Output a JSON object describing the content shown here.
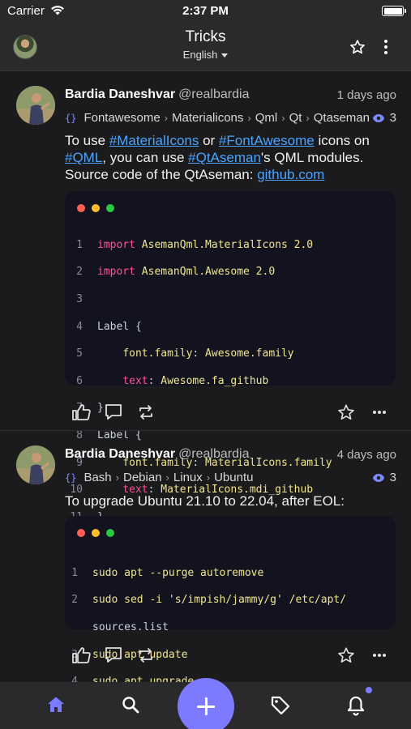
{
  "status": {
    "carrier": "Carrier",
    "time": "2:37 PM"
  },
  "header": {
    "title": "Tricks",
    "language": "English"
  },
  "posts": [
    {
      "author": "Bardia Daneshvar",
      "handle": "@realbardia",
      "time": "1 days ago",
      "tags": [
        "Fontawesome",
        "Materialicons",
        "Qml",
        "Qt",
        "Qtaseman"
      ],
      "views": "3",
      "text": {
        "p1": "To use ",
        "l1": "#MaterialIcons",
        "p2": " or ",
        "l2": "#FontAwesome",
        "p3": " icons on ",
        "l3": "#QML",
        "p4": ", you can use ",
        "l4": "#QtAseman",
        "p5": "'s QML modules. Source code of the QtAseman: ",
        "l5": "github.com"
      },
      "code": [
        {
          "n": "1",
          "a": "import",
          "b": " AsemanQml.MaterialIcons 2.0"
        },
        {
          "n": "2",
          "a": "import",
          "b": " AsemanQml.Awesome 2.0"
        },
        {
          "n": "3",
          "a": "",
          "b": ""
        },
        {
          "n": "4",
          "a": "",
          "b": "Label {"
        },
        {
          "n": "5",
          "a": "",
          "b": "font.family: Awesome.family"
        },
        {
          "n": "6",
          "a": "",
          "b": "text: Awesome.fa_github"
        },
        {
          "n": "7",
          "a": "",
          "b": "}"
        },
        {
          "n": "8",
          "a": "",
          "b": "Label {"
        },
        {
          "n": "9",
          "a": "",
          "b": "font.family: MaterialIcons.family"
        },
        {
          "n": "10",
          "a": "",
          "b": "text: MaterialIcons.mdi_github"
        },
        {
          "n": "11",
          "a": "",
          "b": "}"
        }
      ]
    },
    {
      "author": "Bardia Daneshvar",
      "handle": "@realbardia",
      "time": "4 days ago",
      "tags": [
        "Bash",
        "Debian",
        "Linux",
        "Ubuntu"
      ],
      "views": "3",
      "text": "To upgrade Ubuntu 21.10 to 22.04, after EOL:",
      "code": [
        {
          "n": "1",
          "line": "sudo apt --purge autoremove"
        },
        {
          "n": "2",
          "line": "sudo sed -i 's/impish/jammy/g' /etc/apt/"
        },
        {
          "n": "",
          "line": "sources.list"
        },
        {
          "n": "3",
          "line": "sudo apt update"
        },
        {
          "n": "4",
          "line": "sudo apt upgrade"
        }
      ]
    }
  ],
  "colors": {
    "accent": "#7c7bff",
    "link": "#4aa3ff",
    "background": "#1b1b1d",
    "code_bg": "#13131f"
  },
  "tabs": [
    "home-icon",
    "search-icon",
    "add-icon",
    "tag-icon",
    "bell-icon"
  ]
}
